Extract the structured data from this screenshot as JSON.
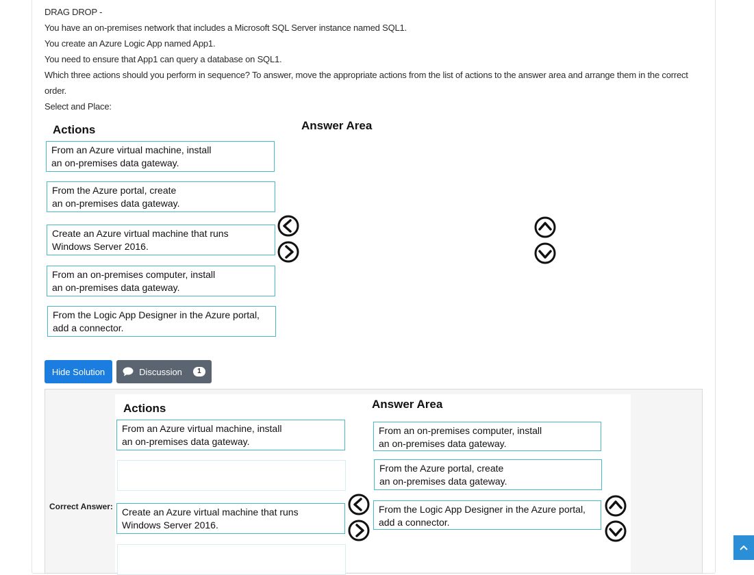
{
  "question": {
    "type_label": "DRAG DROP -",
    "lines": [
      "You have an on-premises network that includes a Microsoft SQL Server instance named SQL1.",
      "You create an Azure Logic App named App1.",
      "You need to ensure that App1 can query a database on SQL1.",
      "Which three actions should you perform in sequence? To answer, move the appropriate actions from the list of actions to the answer area and arrange them in the correct order.",
      "Select and Place:"
    ]
  },
  "exhibit": {
    "actions_title": "Actions",
    "answer_title": "Answer Area",
    "actions": [
      "From an Azure virtual machine, install\nan on-premises data gateway.",
      "From the Azure portal, create\nan on-premises data gateway.",
      "Create an Azure virtual machine that runs\nWindows Server 2016.",
      "From an on-premises computer, install\nan on-premises data gateway.",
      "From the Logic App Designer in the Azure portal,\nadd a connector."
    ]
  },
  "buttons": {
    "hide_solution": "Hide Solution",
    "discussion": "Discussion",
    "discussion_count": "1"
  },
  "solution": {
    "correct_answer_label": "Correct Answer:",
    "actions_title": "Actions",
    "answer_title": "Answer Area",
    "remaining_actions": [
      "From an Azure virtual machine, install\nan on-premises data gateway.",
      "",
      "Create an Azure virtual machine that runs\nWindows Server 2016.",
      ""
    ],
    "answer_sequence": [
      "From an on-premises computer, install\nan on-premises data gateway.",
      "From the Azure portal, create\nan on-premises data gateway.",
      "From the Logic App Designer in the Azure portal,\nadd a connector."
    ]
  },
  "colors": {
    "box_border": "#4bb8c8",
    "primary_button": "#1b7de0",
    "secondary_button": "#5b6571",
    "scroll_top_button": "#2a8fd6"
  },
  "icons": {
    "arrow_left": "chevron-left-circle-icon",
    "arrow_right": "chevron-right-circle-icon",
    "arrow_up": "chevron-up-circle-icon",
    "arrow_down": "chevron-down-circle-icon",
    "discussion": "comment-icon",
    "scroll_top": "chevron-up-icon"
  }
}
